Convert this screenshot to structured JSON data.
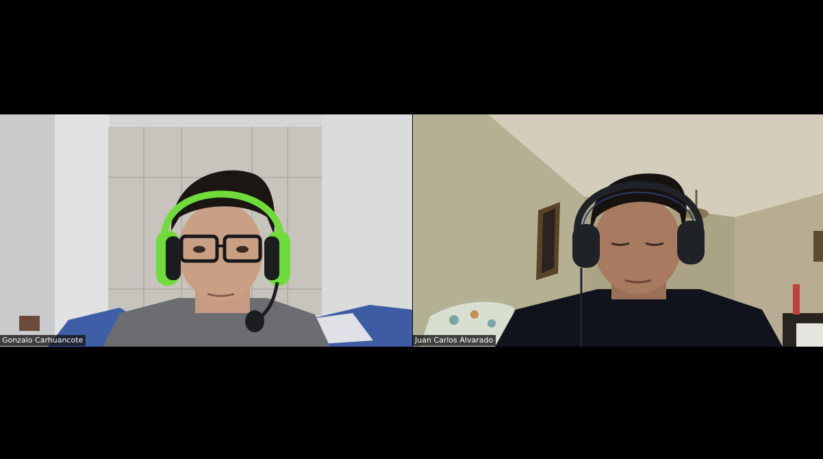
{
  "participants": [
    {
      "name": "Gonzalo Carhuancote",
      "headset_color": "#6fdc3a",
      "shirt_color": "#6b6d70"
    },
    {
      "name": "Juan Carlos Alvarado",
      "headset_color": "#1f2226",
      "shirt_color": "#10121c"
    }
  ],
  "colors": {
    "background": "#000000",
    "name_tag_bg": "#141414",
    "name_tag_text": "#ffffff"
  }
}
